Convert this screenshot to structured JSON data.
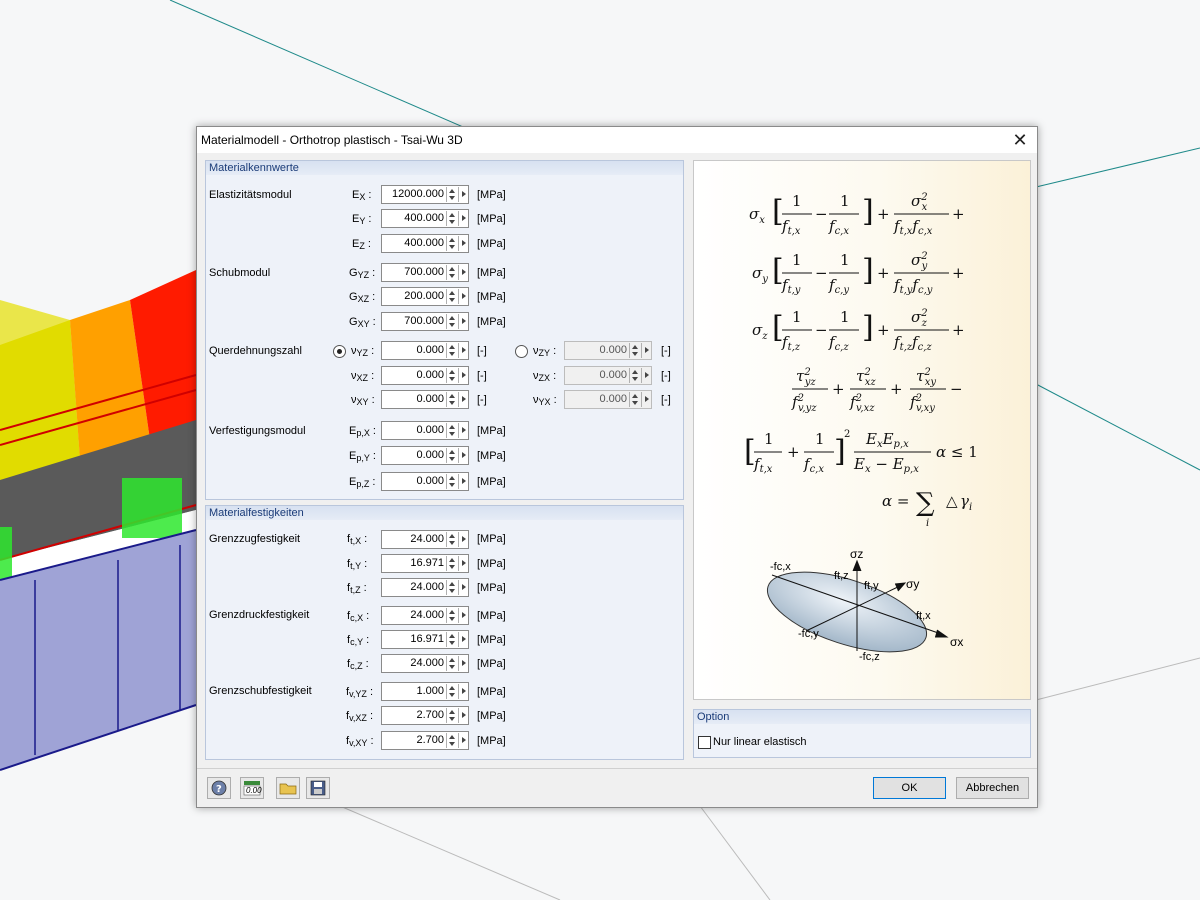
{
  "window": {
    "title": "Materialmodell - Orthotrop plastisch - Tsai-Wu 3D",
    "close_label": "✕"
  },
  "units": {
    "mpa": "[MPa]",
    "dimless": "[-]"
  },
  "material_params": {
    "header": "Materialkennwerte",
    "elastizitaet": {
      "label": "Elastizitätsmodul",
      "ex": "12000.000",
      "ey": "400.000",
      "ez": "400.000"
    },
    "schub": {
      "label": "Schubmodul",
      "gyz": "700.000",
      "gxz": "200.000",
      "gxy": "700.000"
    },
    "querdehnung": {
      "label": "Querdehnungszahl",
      "vyz": "0.000",
      "vxz": "0.000",
      "vxy": "0.000",
      "vzy": "0.000",
      "vzx": "0.000",
      "vyx": "0.000",
      "selected": "vyz"
    },
    "verfestigung": {
      "label": "Verfestigungsmodul",
      "epx": "0.000",
      "epy": "0.000",
      "epz": "0.000"
    }
  },
  "strengths": {
    "header": "Materialfestigkeiten",
    "zug": {
      "label": "Grenzzugfestigkeit",
      "ftx": "24.000",
      "fty": "16.971",
      "ftz": "24.000"
    },
    "druck": {
      "label": "Grenzdruckfestigkeit",
      "fcx": "24.000",
      "fcy": "16.971",
      "fcz": "24.000"
    },
    "schub": {
      "label": "Grenzschubfestigkeit",
      "fvyz": "1.000",
      "fvxz": "2.700",
      "fvxy": "2.700"
    }
  },
  "diagram": {
    "sz": "σz",
    "sy": "σy",
    "sx": "σx",
    "fcx_neg": "-fc,x",
    "ftz": "ft,z",
    "fty": "ft,y",
    "ftx": "ft,x",
    "fcy_neg": "-fc,y",
    "fcz_neg": "-fc,z"
  },
  "option": {
    "header": "Option",
    "checkbox_label": "Nur linear elastisch",
    "checked": false
  },
  "buttons": {
    "ok": "OK",
    "cancel": "Abbrechen"
  },
  "toolbar": {
    "units_icon_text": "0.00"
  },
  "colors": {
    "group_header_text": "#1a3b78",
    "group_bg": "#eef2f9",
    "ok_border": "#0078d7"
  }
}
